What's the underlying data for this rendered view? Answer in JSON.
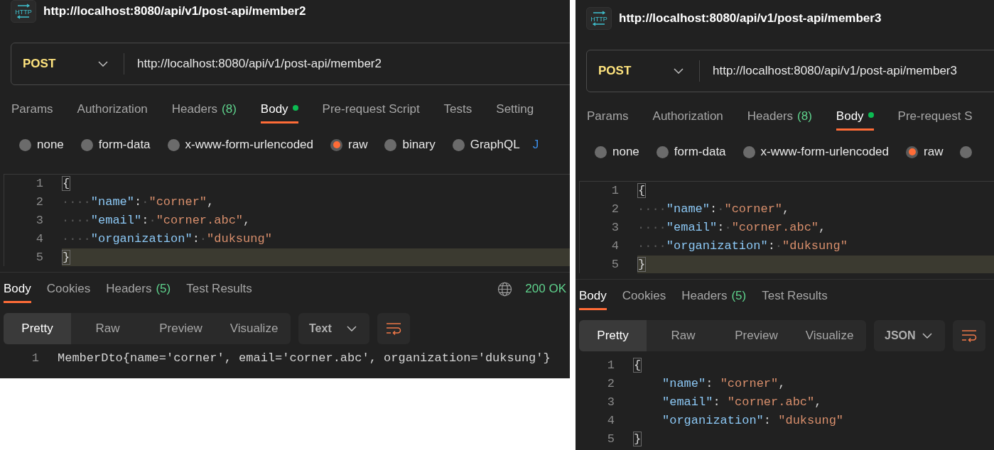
{
  "panels": [
    {
      "icon_label": "HTTP",
      "title": "http://localhost:8080/api/v1/post-api/member2",
      "method": "POST",
      "url": "http://localhost:8080/api/v1/post-api/member2",
      "request_tabs": [
        {
          "label": "Params",
          "selected": false,
          "modified": false
        },
        {
          "label": "Authorization",
          "selected": false,
          "modified": false
        },
        {
          "label": "Headers",
          "count": "(8)",
          "selected": false,
          "modified": false
        },
        {
          "label": "Body",
          "selected": true,
          "modified": true
        },
        {
          "label": "Pre-request Script",
          "selected": false,
          "modified": false
        },
        {
          "label": "Tests",
          "selected": false,
          "modified": false
        },
        {
          "label": "Setting",
          "selected": false,
          "modified": false
        }
      ],
      "body_types": [
        {
          "kind": "radio",
          "label": "none",
          "selected": false
        },
        {
          "kind": "radio",
          "label": "form-data",
          "selected": false
        },
        {
          "kind": "radio",
          "label": "x-www-form-urlencoded",
          "selected": false
        },
        {
          "kind": "radio",
          "label": "raw",
          "selected": true
        },
        {
          "kind": "radio",
          "label": "binary",
          "selected": false
        },
        {
          "kind": "radio",
          "label": "GraphQL",
          "selected": false
        },
        {
          "kind": "link",
          "label": "J"
        }
      ],
      "editor_lines": [
        {
          "number": "1",
          "current": false,
          "tokens": [
            {
              "kind": "brace",
              "text": "{"
            }
          ]
        },
        {
          "number": "2",
          "current": false,
          "tokens": [
            {
              "kind": "space",
              "text": "····"
            },
            {
              "kind": "key",
              "text": "\"name\""
            },
            {
              "kind": "punct",
              "text": ":"
            },
            {
              "kind": "space",
              "text": "·"
            },
            {
              "kind": "string",
              "text": "\"corner\""
            },
            {
              "kind": "punct",
              "text": ","
            }
          ]
        },
        {
          "number": "3",
          "current": false,
          "tokens": [
            {
              "kind": "space",
              "text": "····"
            },
            {
              "kind": "key",
              "text": "\"email\""
            },
            {
              "kind": "punct",
              "text": ":"
            },
            {
              "kind": "space",
              "text": "·"
            },
            {
              "kind": "string",
              "text": "\"corner.abc\""
            },
            {
              "kind": "punct",
              "text": ","
            }
          ]
        },
        {
          "number": "4",
          "current": false,
          "tokens": [
            {
              "kind": "space",
              "text": "····"
            },
            {
              "kind": "key",
              "text": "\"organization\""
            },
            {
              "kind": "punct",
              "text": ":"
            },
            {
              "kind": "space",
              "text": "·"
            },
            {
              "kind": "string",
              "text": "\"duksung\""
            }
          ]
        },
        {
          "number": "5",
          "current": true,
          "tokens": [
            {
              "kind": "brace",
              "text": "}"
            }
          ]
        }
      ],
      "response_tabs": [
        {
          "label": "Body",
          "selected": true
        },
        {
          "label": "Cookies",
          "selected": false
        },
        {
          "label": "Headers",
          "count": "(5)",
          "selected": false
        },
        {
          "label": "Test Results",
          "selected": false
        }
      ],
      "status": "200 OK",
      "view_modes": [
        {
          "label": "Pretty",
          "selected": true
        },
        {
          "label": "Raw",
          "selected": false
        },
        {
          "label": "Preview",
          "selected": false
        },
        {
          "label": "Visualize",
          "selected": false
        }
      ],
      "format": "Text",
      "response_lines": [
        {
          "number": "1",
          "tokens": [
            {
              "kind": "punct",
              "text": "MemberDto{name='corner', email='corner.abc', organization='duksung'}"
            }
          ]
        }
      ]
    },
    {
      "icon_label": "HTTP",
      "title": "http://localhost:8080/api/v1/post-api/member3",
      "method": "POST",
      "url": "http://localhost:8080/api/v1/post-api/member3",
      "request_tabs": [
        {
          "label": "Params",
          "selected": false,
          "modified": false
        },
        {
          "label": "Authorization",
          "selected": false,
          "modified": false
        },
        {
          "label": "Headers",
          "count": "(8)",
          "selected": false,
          "modified": false
        },
        {
          "label": "Body",
          "selected": true,
          "modified": true
        },
        {
          "label": "Pre-request S",
          "selected": false,
          "modified": false
        }
      ],
      "body_types": [
        {
          "kind": "radio",
          "label": "none",
          "selected": false
        },
        {
          "kind": "radio",
          "label": "form-data",
          "selected": false
        },
        {
          "kind": "radio",
          "label": "x-www-form-urlencoded",
          "selected": false
        },
        {
          "kind": "radio",
          "label": "raw",
          "selected": true
        },
        {
          "kind": "radio",
          "selected": false
        }
      ],
      "editor_lines": [
        {
          "number": "1",
          "current": false,
          "tokens": [
            {
              "kind": "brace",
              "text": "{"
            }
          ]
        },
        {
          "number": "2",
          "current": false,
          "tokens": [
            {
              "kind": "space",
              "text": "····"
            },
            {
              "kind": "key",
              "text": "\"name\""
            },
            {
              "kind": "punct",
              "text": ":"
            },
            {
              "kind": "space",
              "text": "·"
            },
            {
              "kind": "string",
              "text": "\"corner\""
            },
            {
              "kind": "punct",
              "text": ","
            }
          ]
        },
        {
          "number": "3",
          "current": false,
          "tokens": [
            {
              "kind": "space",
              "text": "····"
            },
            {
              "kind": "key",
              "text": "\"email\""
            },
            {
              "kind": "punct",
              "text": ":"
            },
            {
              "kind": "space",
              "text": "·"
            },
            {
              "kind": "string",
              "text": "\"corner.abc\""
            },
            {
              "kind": "punct",
              "text": ","
            }
          ]
        },
        {
          "number": "4",
          "current": false,
          "tokens": [
            {
              "kind": "space",
              "text": "····"
            },
            {
              "kind": "key",
              "text": "\"organization\""
            },
            {
              "kind": "punct",
              "text": ":"
            },
            {
              "kind": "space",
              "text": "·"
            },
            {
              "kind": "string",
              "text": "\"duksung\""
            }
          ]
        },
        {
          "number": "5",
          "current": true,
          "tokens": [
            {
              "kind": "brace",
              "text": "}"
            }
          ]
        }
      ],
      "response_tabs": [
        {
          "label": "Body",
          "selected": true
        },
        {
          "label": "Cookies",
          "selected": false
        },
        {
          "label": "Headers",
          "count": "(5)",
          "selected": false
        },
        {
          "label": "Test Results",
          "selected": false
        }
      ],
      "view_modes": [
        {
          "label": "Pretty",
          "selected": true
        },
        {
          "label": "Raw",
          "selected": false
        },
        {
          "label": "Preview",
          "selected": false
        },
        {
          "label": "Visualize",
          "selected": false
        }
      ],
      "format": "JSON",
      "response_lines": [
        {
          "number": "1",
          "tokens": [
            {
              "kind": "brace",
              "text": "{"
            }
          ]
        },
        {
          "number": "2",
          "tokens": [
            {
              "kind": "indent"
            },
            {
              "kind": "key",
              "text": "\"name\""
            },
            {
              "kind": "punct",
              "text": ": "
            },
            {
              "kind": "string",
              "text": "\"corner\""
            },
            {
              "kind": "punct",
              "text": ","
            }
          ]
        },
        {
          "number": "3",
          "tokens": [
            {
              "kind": "indent"
            },
            {
              "kind": "key",
              "text": "\"email\""
            },
            {
              "kind": "punct",
              "text": ": "
            },
            {
              "kind": "string",
              "text": "\"corner.abc\""
            },
            {
              "kind": "punct",
              "text": ","
            }
          ]
        },
        {
          "number": "4",
          "tokens": [
            {
              "kind": "indent"
            },
            {
              "kind": "key",
              "text": "\"organization\""
            },
            {
              "kind": "punct",
              "text": ": "
            },
            {
              "kind": "string",
              "text": "\"duksung\""
            }
          ]
        },
        {
          "number": "5",
          "tokens": [
            {
              "kind": "brace",
              "text": "}"
            }
          ]
        }
      ]
    }
  ]
}
